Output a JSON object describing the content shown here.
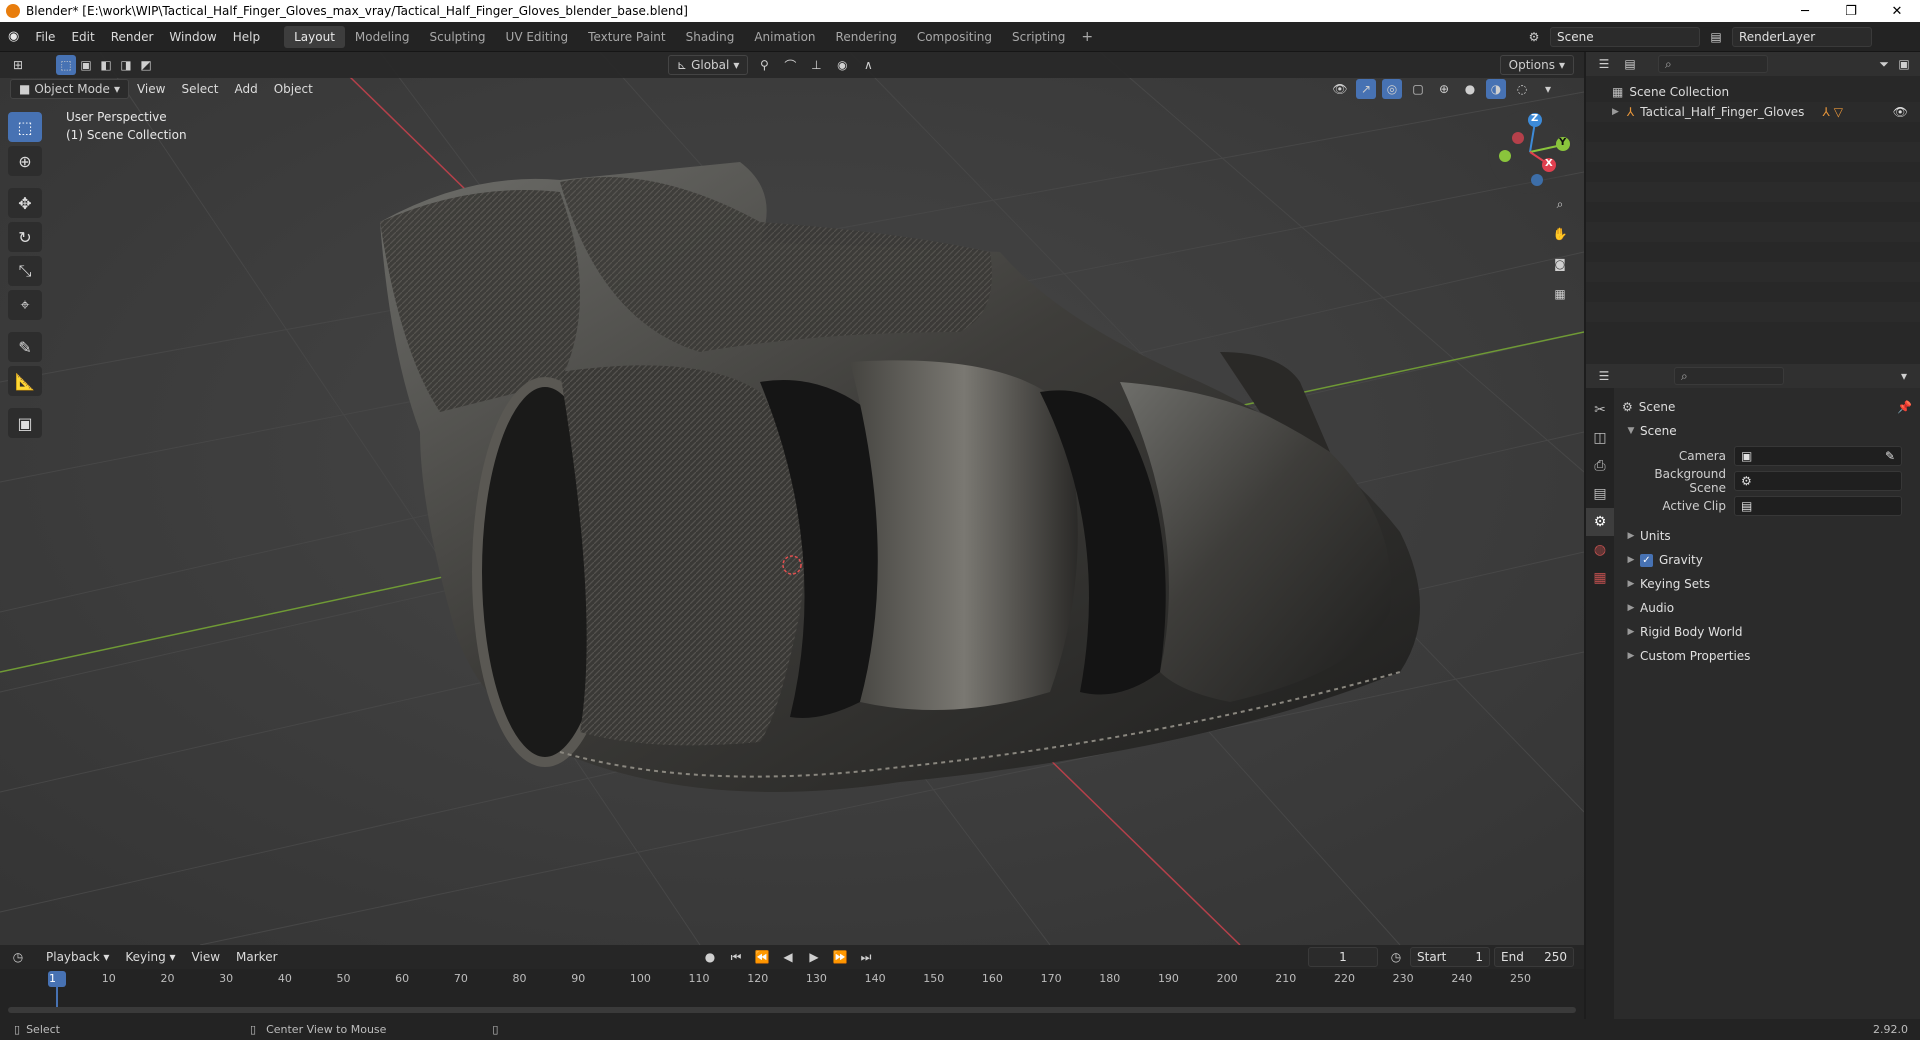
{
  "window": {
    "title": "Blender* [E:\\work\\WIP\\Tactical_Half_Finger_Gloves_max_vray/Tactical_Half_Finger_Gloves_blender_base.blend]",
    "controls": [
      "─",
      "❐",
      "✕"
    ]
  },
  "menu": [
    "File",
    "Edit",
    "Render",
    "Window",
    "Help"
  ],
  "workspaces": [
    "Layout",
    "Modeling",
    "Sculpting",
    "UV Editing",
    "Texture Paint",
    "Shading",
    "Animation",
    "Rendering",
    "Compositing",
    "Scripting"
  ],
  "active_workspace": "Layout",
  "scene_field": "Scene",
  "view_layer_field": "RenderLayer",
  "viewport": {
    "mode": "Object Mode",
    "menus": [
      "View",
      "Select",
      "Add",
      "Object"
    ],
    "transform_orientation": "Global",
    "options_label": "Options",
    "overlay_line1": "User Perspective",
    "overlay_line2": "(1) Scene Collection",
    "gizmo_axes": {
      "z": "Z",
      "y": "Y",
      "x": "X"
    },
    "colors": {
      "axis_x": "#e0404f",
      "axis_y": "#8ac53c",
      "axis_z": "#3d8bd9",
      "accent": "#4772b3"
    }
  },
  "outliner": {
    "root": "Scene Collection",
    "items": [
      {
        "label": "Tactical_Half_Finger_Gloves"
      }
    ]
  },
  "properties": {
    "context": "Scene",
    "panel_title": "Scene",
    "fields": [
      {
        "label": "Camera",
        "value": ""
      },
      {
        "label": "Background Scene",
        "value": ""
      },
      {
        "label": "Active Clip",
        "value": ""
      }
    ],
    "sections": [
      {
        "label": "Units",
        "checkbox": false
      },
      {
        "label": "Gravity",
        "checkbox": true
      },
      {
        "label": "Keying Sets",
        "checkbox": false
      },
      {
        "label": "Audio",
        "checkbox": false
      },
      {
        "label": "Rigid Body World",
        "checkbox": false
      },
      {
        "label": "Custom Properties",
        "checkbox": false
      }
    ]
  },
  "timeline": {
    "menus": [
      "Playback",
      "Keying",
      "View",
      "Marker"
    ],
    "current_frame": "1",
    "start_label": "Start",
    "start": "1",
    "end_label": "End",
    "end": "250",
    "ticks": [
      "1",
      "10",
      "20",
      "30",
      "40",
      "50",
      "60",
      "70",
      "80",
      "90",
      "100",
      "110",
      "120",
      "130",
      "140",
      "150",
      "160",
      "170",
      "180",
      "190",
      "200",
      "210",
      "220",
      "230",
      "240",
      "250"
    ]
  },
  "status": {
    "left": "Select",
    "middle": "Center View to Mouse",
    "version": "2.92.0"
  }
}
